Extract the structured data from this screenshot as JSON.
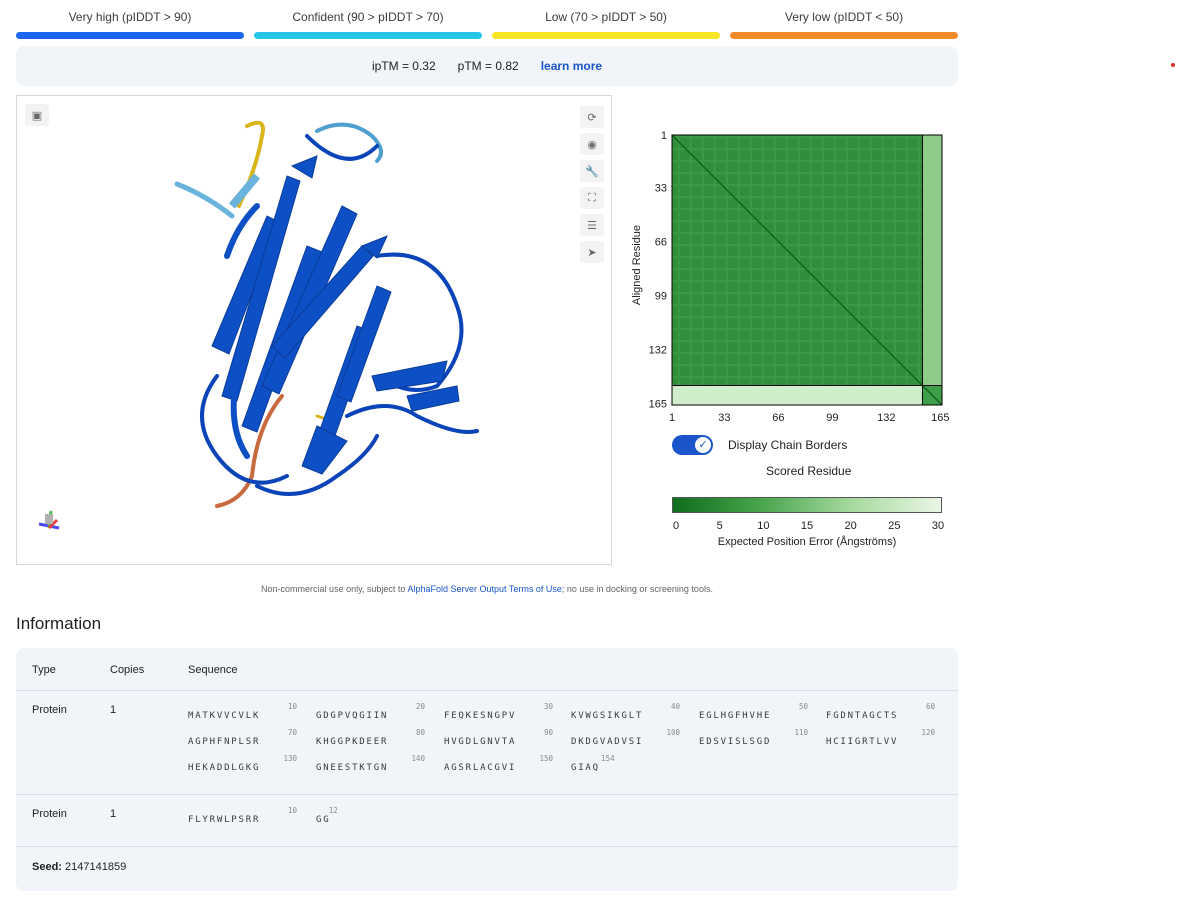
{
  "legend": {
    "items": [
      {
        "label": "Very high (pIDDT > 90)",
        "color": "#1a66f0"
      },
      {
        "label": "Confident (90 > pIDDT > 70)",
        "color": "#26c6e8"
      },
      {
        "label": "Low (70 > pIDDT > 50)",
        "color": "#f7e526"
      },
      {
        "label": "Very low (pIDDT < 50)",
        "color": "#f08a2a"
      }
    ]
  },
  "metrics": {
    "iptm": "ipTM = 0.32",
    "ptm": "pTM = 0.82",
    "learn_more": "learn more"
  },
  "viewer": {
    "toolbar_icons": [
      "rotate-icon",
      "focus-icon",
      "wrench-icon",
      "fullscreen-icon",
      "settings-sliders-icon",
      "pointer-icon"
    ],
    "snapshot_icon": "camera-icon"
  },
  "pae": {
    "ylabel": "Aligned Residue",
    "xlabel": "Scored Residue",
    "ticks": [
      "1",
      "33",
      "66",
      "99",
      "132",
      "165"
    ],
    "chain_border_residue": 154,
    "total_residues": 166
  },
  "toggle": {
    "label": "Display Chain Borders",
    "checked": true
  },
  "colorbar": {
    "ticks": [
      "0",
      "5",
      "10",
      "15",
      "20",
      "25",
      "30"
    ],
    "title": "Expected Position Error (Ångströms)"
  },
  "notice": {
    "prefix": "Non-commercial use only, subject to ",
    "link": "AlphaFold Server Output Terms of Use",
    "suffix": "; no use in docking or screening tools."
  },
  "information": {
    "title": "Information",
    "headers": {
      "type": "Type",
      "copies": "Copies",
      "sequence": "Sequence"
    },
    "entities": [
      {
        "type": "Protein",
        "copies": "1",
        "lines": [
          {
            "blocks": [
              {
                "num": "10",
                "seq": "MATKVVCVLK"
              },
              {
                "num": "20",
                "seq": "GDGPVQGIIN"
              },
              {
                "num": "30",
                "seq": "FEQKESNGPV"
              },
              {
                "num": "40",
                "seq": "KVWGSIKGLT"
              },
              {
                "num": "50",
                "seq": "EGLHGFHVHE"
              },
              {
                "num": "60",
                "seq": "FGDNTAGCTS"
              }
            ]
          },
          {
            "blocks": [
              {
                "num": "70",
                "seq": "AGPHFNPLSR"
              },
              {
                "num": "80",
                "seq": "KHGGPKDEER"
              },
              {
                "num": "90",
                "seq": "HVGDLGNVTA"
              },
              {
                "num": "100",
                "seq": "DKDGVADVSI"
              },
              {
                "num": "110",
                "seq": "EDSVISLSGD"
              },
              {
                "num": "120",
                "seq": "HCIIGRTLVV"
              }
            ]
          },
          {
            "blocks": [
              {
                "num": "130",
                "seq": "HEKADDLGKG"
              },
              {
                "num": "140",
                "seq": "GNEESTKTGN"
              },
              {
                "num": "150",
                "seq": "AGSRLACGVI"
              },
              {
                "num": "154",
                "seq": "GIAQ"
              }
            ]
          }
        ]
      },
      {
        "type": "Protein",
        "copies": "1",
        "lines": [
          {
            "blocks": [
              {
                "num": "10",
                "seq": "FLYRWLPSRR"
              },
              {
                "num": "12",
                "seq": "GG"
              }
            ]
          }
        ]
      }
    ],
    "seed_label": "Seed:",
    "seed_value": "2147141859"
  }
}
